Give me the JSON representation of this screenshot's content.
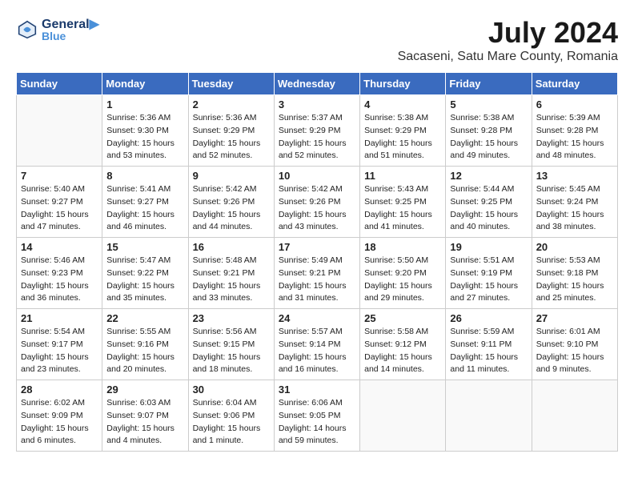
{
  "header": {
    "logo_line1": "General",
    "logo_line2": "Blue",
    "month": "July 2024",
    "location": "Sacaseni, Satu Mare County, Romania"
  },
  "weekdays": [
    "Sunday",
    "Monday",
    "Tuesday",
    "Wednesday",
    "Thursday",
    "Friday",
    "Saturday"
  ],
  "weeks": [
    [
      {
        "day": "",
        "info": ""
      },
      {
        "day": "1",
        "info": "Sunrise: 5:36 AM\nSunset: 9:30 PM\nDaylight: 15 hours\nand 53 minutes."
      },
      {
        "day": "2",
        "info": "Sunrise: 5:36 AM\nSunset: 9:29 PM\nDaylight: 15 hours\nand 52 minutes."
      },
      {
        "day": "3",
        "info": "Sunrise: 5:37 AM\nSunset: 9:29 PM\nDaylight: 15 hours\nand 52 minutes."
      },
      {
        "day": "4",
        "info": "Sunrise: 5:38 AM\nSunset: 9:29 PM\nDaylight: 15 hours\nand 51 minutes."
      },
      {
        "day": "5",
        "info": "Sunrise: 5:38 AM\nSunset: 9:28 PM\nDaylight: 15 hours\nand 49 minutes."
      },
      {
        "day": "6",
        "info": "Sunrise: 5:39 AM\nSunset: 9:28 PM\nDaylight: 15 hours\nand 48 minutes."
      }
    ],
    [
      {
        "day": "7",
        "info": "Sunrise: 5:40 AM\nSunset: 9:27 PM\nDaylight: 15 hours\nand 47 minutes."
      },
      {
        "day": "8",
        "info": "Sunrise: 5:41 AM\nSunset: 9:27 PM\nDaylight: 15 hours\nand 46 minutes."
      },
      {
        "day": "9",
        "info": "Sunrise: 5:42 AM\nSunset: 9:26 PM\nDaylight: 15 hours\nand 44 minutes."
      },
      {
        "day": "10",
        "info": "Sunrise: 5:42 AM\nSunset: 9:26 PM\nDaylight: 15 hours\nand 43 minutes."
      },
      {
        "day": "11",
        "info": "Sunrise: 5:43 AM\nSunset: 9:25 PM\nDaylight: 15 hours\nand 41 minutes."
      },
      {
        "day": "12",
        "info": "Sunrise: 5:44 AM\nSunset: 9:25 PM\nDaylight: 15 hours\nand 40 minutes."
      },
      {
        "day": "13",
        "info": "Sunrise: 5:45 AM\nSunset: 9:24 PM\nDaylight: 15 hours\nand 38 minutes."
      }
    ],
    [
      {
        "day": "14",
        "info": "Sunrise: 5:46 AM\nSunset: 9:23 PM\nDaylight: 15 hours\nand 36 minutes."
      },
      {
        "day": "15",
        "info": "Sunrise: 5:47 AM\nSunset: 9:22 PM\nDaylight: 15 hours\nand 35 minutes."
      },
      {
        "day": "16",
        "info": "Sunrise: 5:48 AM\nSunset: 9:21 PM\nDaylight: 15 hours\nand 33 minutes."
      },
      {
        "day": "17",
        "info": "Sunrise: 5:49 AM\nSunset: 9:21 PM\nDaylight: 15 hours\nand 31 minutes."
      },
      {
        "day": "18",
        "info": "Sunrise: 5:50 AM\nSunset: 9:20 PM\nDaylight: 15 hours\nand 29 minutes."
      },
      {
        "day": "19",
        "info": "Sunrise: 5:51 AM\nSunset: 9:19 PM\nDaylight: 15 hours\nand 27 minutes."
      },
      {
        "day": "20",
        "info": "Sunrise: 5:53 AM\nSunset: 9:18 PM\nDaylight: 15 hours\nand 25 minutes."
      }
    ],
    [
      {
        "day": "21",
        "info": "Sunrise: 5:54 AM\nSunset: 9:17 PM\nDaylight: 15 hours\nand 23 minutes."
      },
      {
        "day": "22",
        "info": "Sunrise: 5:55 AM\nSunset: 9:16 PM\nDaylight: 15 hours\nand 20 minutes."
      },
      {
        "day": "23",
        "info": "Sunrise: 5:56 AM\nSunset: 9:15 PM\nDaylight: 15 hours\nand 18 minutes."
      },
      {
        "day": "24",
        "info": "Sunrise: 5:57 AM\nSunset: 9:14 PM\nDaylight: 15 hours\nand 16 minutes."
      },
      {
        "day": "25",
        "info": "Sunrise: 5:58 AM\nSunset: 9:12 PM\nDaylight: 15 hours\nand 14 minutes."
      },
      {
        "day": "26",
        "info": "Sunrise: 5:59 AM\nSunset: 9:11 PM\nDaylight: 15 hours\nand 11 minutes."
      },
      {
        "day": "27",
        "info": "Sunrise: 6:01 AM\nSunset: 9:10 PM\nDaylight: 15 hours\nand 9 minutes."
      }
    ],
    [
      {
        "day": "28",
        "info": "Sunrise: 6:02 AM\nSunset: 9:09 PM\nDaylight: 15 hours\nand 6 minutes."
      },
      {
        "day": "29",
        "info": "Sunrise: 6:03 AM\nSunset: 9:07 PM\nDaylight: 15 hours\nand 4 minutes."
      },
      {
        "day": "30",
        "info": "Sunrise: 6:04 AM\nSunset: 9:06 PM\nDaylight: 15 hours\nand 1 minute."
      },
      {
        "day": "31",
        "info": "Sunrise: 6:06 AM\nSunset: 9:05 PM\nDaylight: 14 hours\nand 59 minutes."
      },
      {
        "day": "",
        "info": ""
      },
      {
        "day": "",
        "info": ""
      },
      {
        "day": "",
        "info": ""
      }
    ]
  ]
}
